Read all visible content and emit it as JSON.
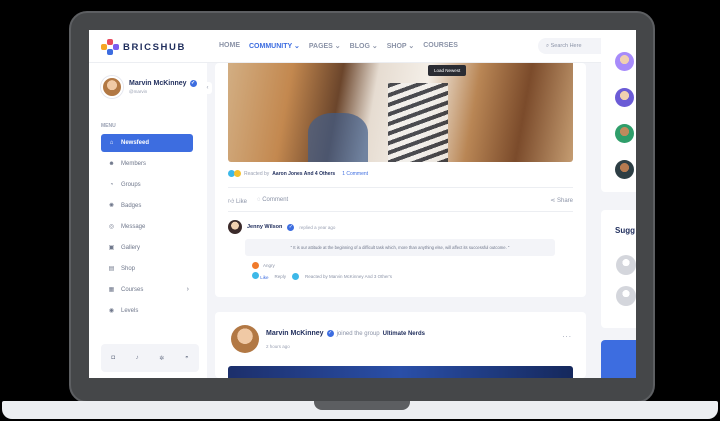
{
  "brand": {
    "name": "BRICSHUB"
  },
  "nav": {
    "items": [
      "HOME",
      "COMMUNITY",
      "PAGES",
      "BLOG",
      "SHOP",
      "COURSES"
    ],
    "active": "COMMUNITY"
  },
  "search": {
    "placeholder": "Search Here"
  },
  "profile": {
    "name": "Marvin McKinney",
    "handle": "@marvin"
  },
  "sidebar": {
    "menu_label": "MENU",
    "items": [
      {
        "label": "Newsfeed",
        "icon": "home-icon"
      },
      {
        "label": "Members",
        "icon": "users-icon"
      },
      {
        "label": "Groups",
        "icon": "groups-icon"
      },
      {
        "label": "Badges",
        "icon": "badge-icon"
      },
      {
        "label": "Message",
        "icon": "message-icon"
      },
      {
        "label": "Gallery",
        "icon": "gallery-icon"
      },
      {
        "label": "Shop",
        "icon": "shop-icon"
      },
      {
        "label": "Courses",
        "icon": "courses-icon"
      },
      {
        "label": "Levels",
        "icon": "levels-icon"
      }
    ]
  },
  "post1": {
    "load_newest": "Load Newest",
    "reacted_prefix": "Reacted by",
    "reacted_names": "Aaron Jones And 4 Others",
    "comment_count": "1 Comment",
    "like_label": "Like",
    "comment_label": "Comment",
    "share_label": "Share",
    "comment": {
      "author": "Jenny Wilson",
      "time": "replied a year ago",
      "text": "\" It is our attitude at the beginning of a difficult task which, more than anything else, will affect its successful outcome. \"",
      "reaction": "Angry",
      "like": "Like",
      "reply": "Reply",
      "reacted_by": "Reacted by Marvin McKinney And 3 Other's"
    }
  },
  "post2": {
    "author": "Marvin McKinney",
    "action": "joined the group",
    "group": "Ultimate Nerds",
    "time": "2 hours ago",
    "more": "..."
  },
  "right": {
    "suggestions_title": "Sugg"
  },
  "colors": {
    "accent": "#3d6de0",
    "navy": "#1f2d5c",
    "muted": "#8b93a7"
  }
}
